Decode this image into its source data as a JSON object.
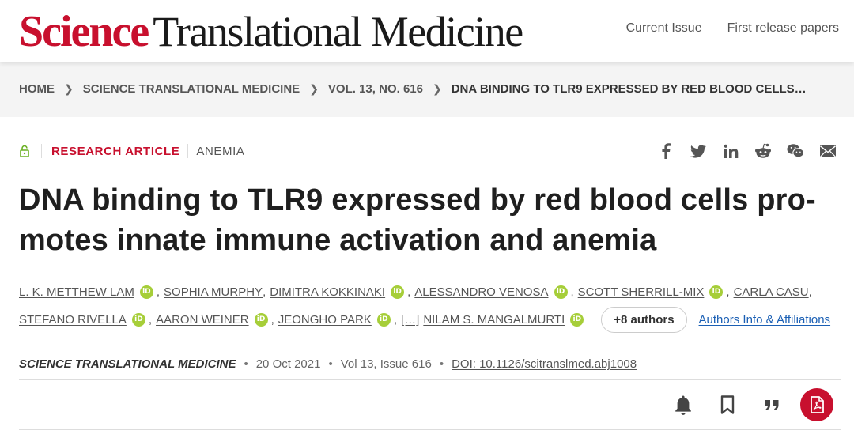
{
  "header": {
    "logo_science": "Science",
    "logo_rest": "Translational Medicine",
    "nav": [
      "Current Issue",
      "First release papers"
    ]
  },
  "breadcrumb": [
    "HOME",
    "SCIENCE TRANSLATIONAL MEDICINE",
    "VOL. 13, NO. 616",
    "DNA BINDING TO TLR9 EXPRESSED BY RED BLOOD CELLS…"
  ],
  "article": {
    "type": "RESEARCH ARTICLE",
    "subject": "ANEMIA",
    "title_line1": "DNA binding to TLR9 expressed by red blood cells pro-",
    "title_line2": "motes innate immune activation and anemia",
    "share_icons": [
      "facebook-icon",
      "twitter-icon",
      "linkedin-icon",
      "reddit-icon",
      "wechat-icon",
      "email-icon"
    ]
  },
  "authors": {
    "line1": [
      "L. K. METTHEW LAM",
      "SOPHIA MURPHY",
      "DIMITRA KOKKINAKI",
      "ALESSANDRO VENOSA",
      "SCOTT SHERRILL-MIX",
      "CARLA CASU"
    ],
    "line2": [
      "STEFANO RIVELLA",
      "AARON WEINER",
      "JEONGHO PARK",
      "[…]",
      "NILAM S. MANGALMURTI"
    ],
    "orcid_label": "iD",
    "more": "+8 authors",
    "affiliations": "Authors Info & Affiliations"
  },
  "publication": {
    "journal": "SCIENCE TRANSLATIONAL MEDICINE",
    "date": "20 Oct 2021",
    "volume": "Vol 13, Issue 616",
    "doi": "DOI: 10.1126/scitranslmed.abj1008"
  },
  "colors": {
    "brand": "#c8102e",
    "orcid": "#a6ce39",
    "link": "#1a5fb4"
  }
}
